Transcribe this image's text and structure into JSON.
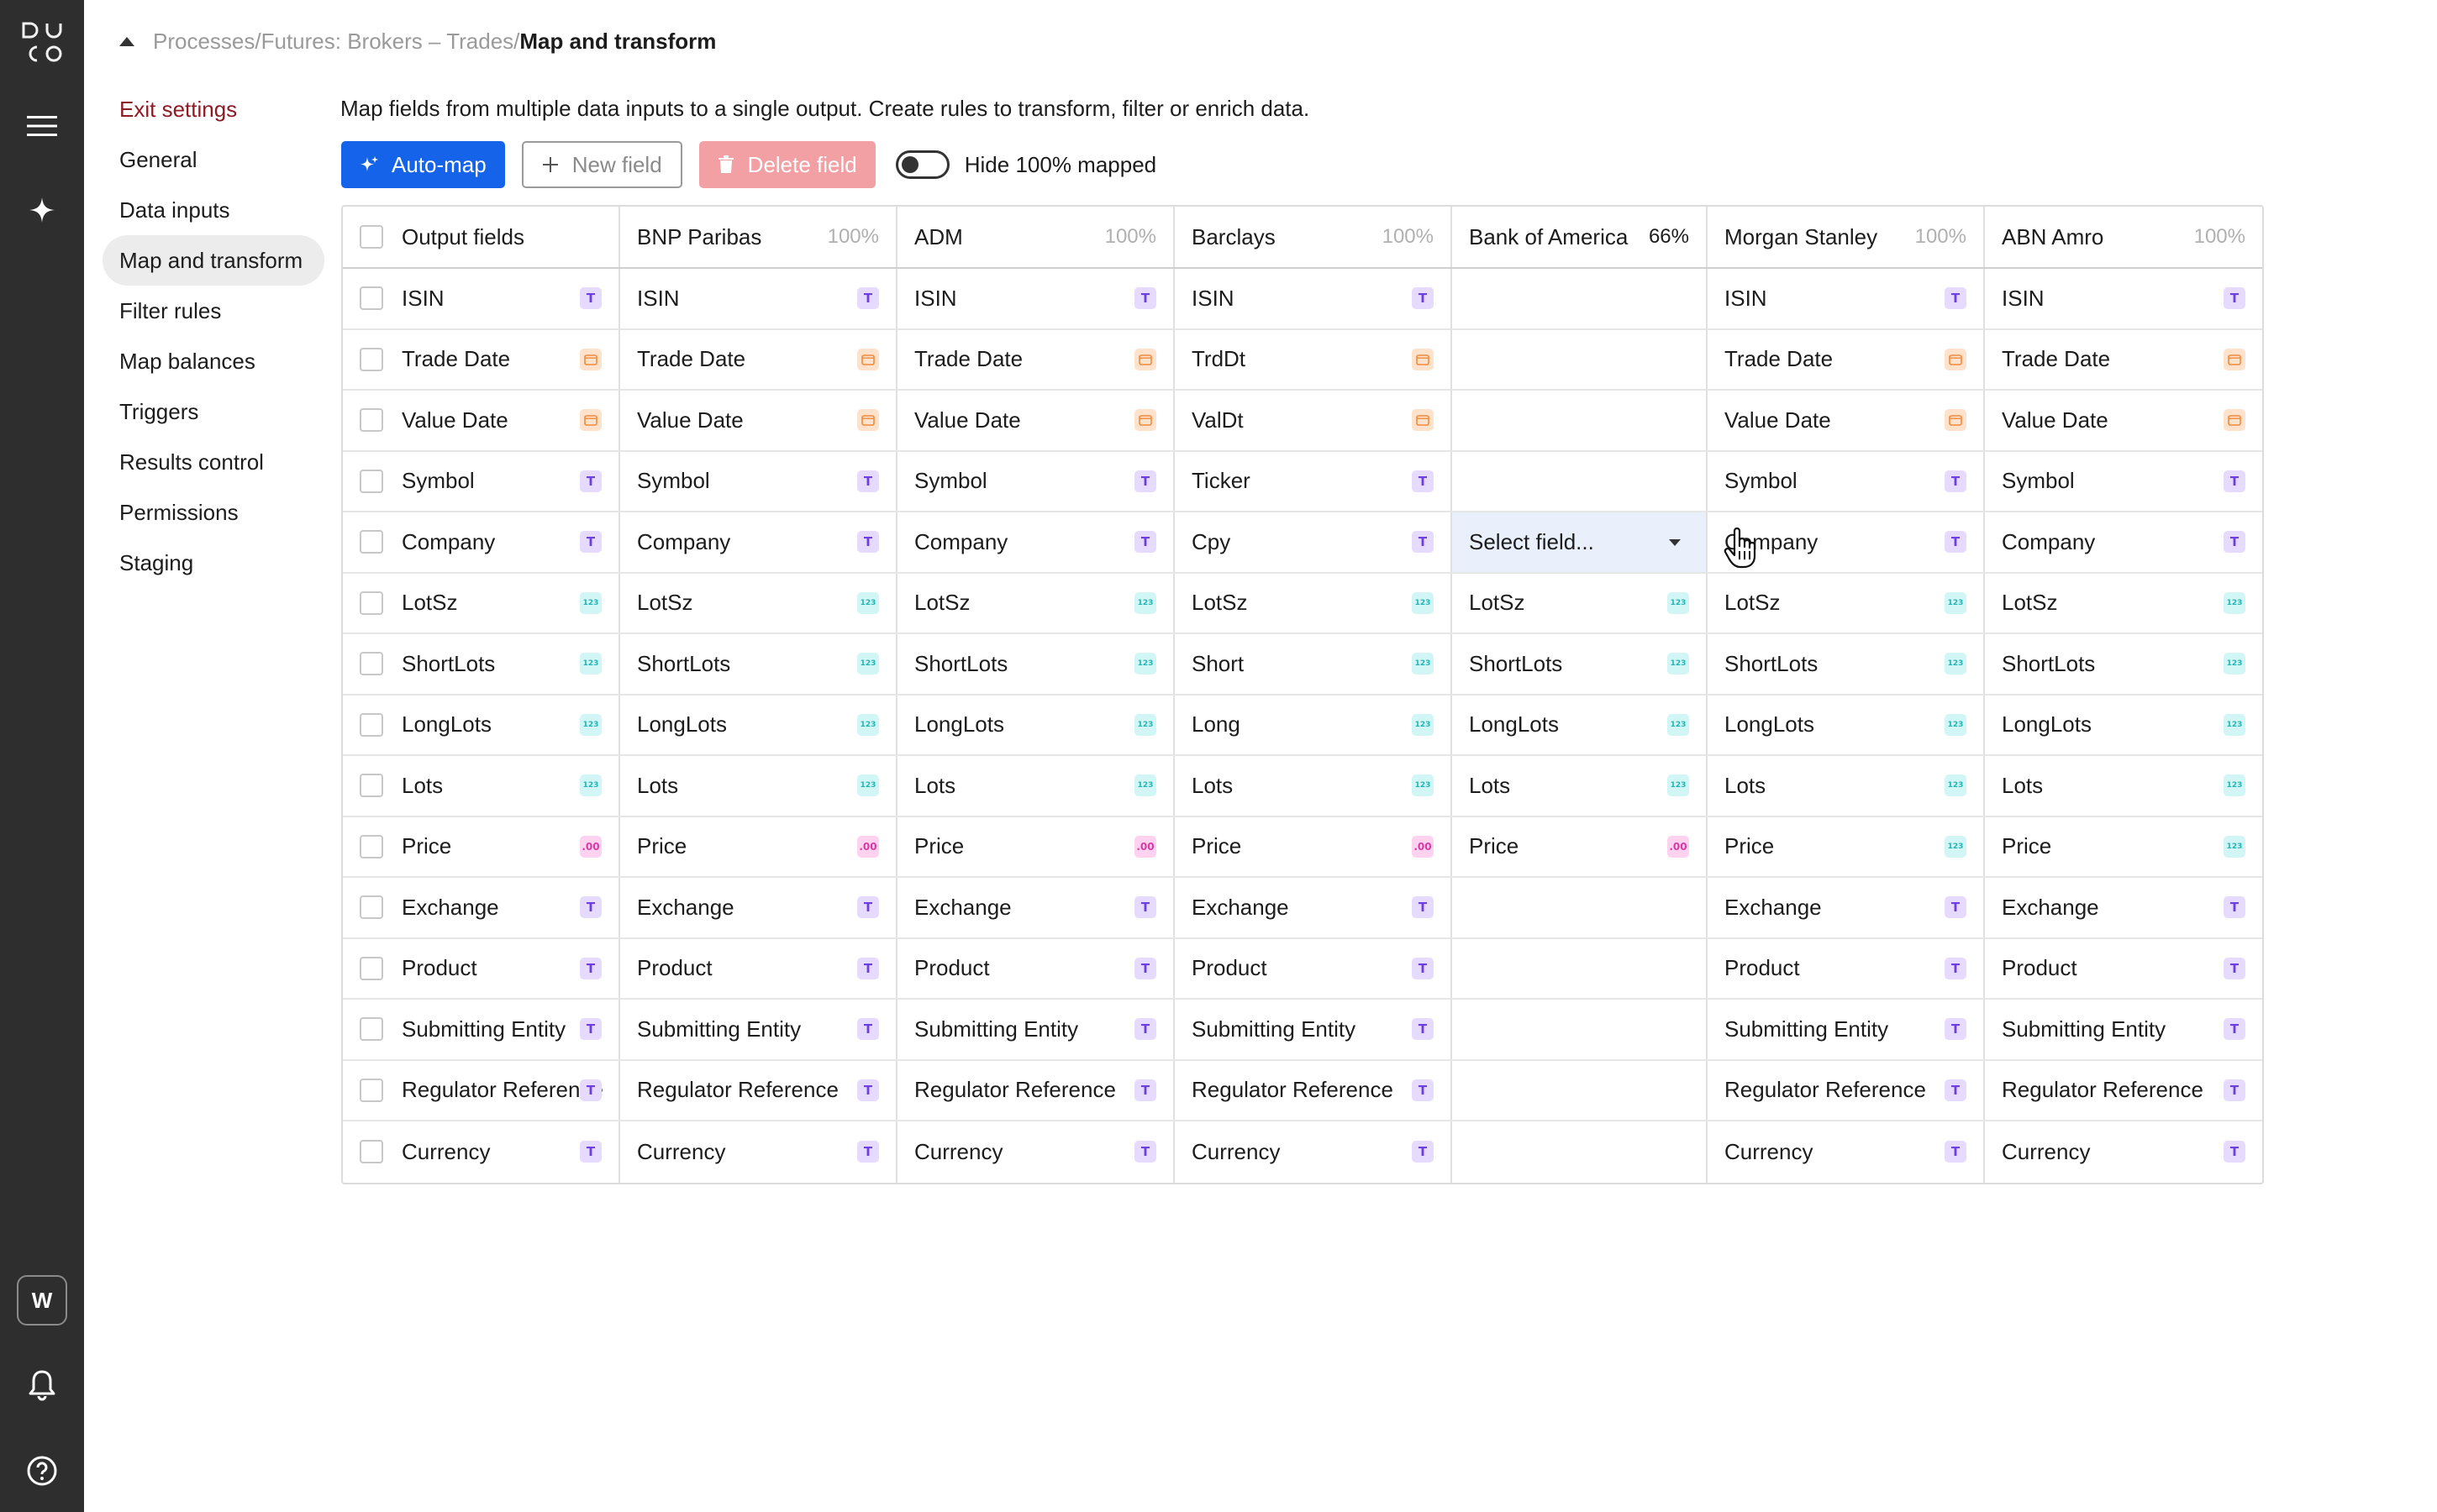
{
  "app": {
    "logo_letters": "DUCO",
    "workspace_initial": "W"
  },
  "breadcrumb": {
    "path": "Processes/Futures: Brokers – Trades/",
    "current": "Map and transform"
  },
  "settings_nav": [
    {
      "label": "Exit settings"
    },
    {
      "label": "General"
    },
    {
      "label": "Data inputs"
    },
    {
      "label": "Map and transform"
    },
    {
      "label": "Filter rules"
    },
    {
      "label": "Map balances"
    },
    {
      "label": "Triggers"
    },
    {
      "label": "Results control"
    },
    {
      "label": "Permissions"
    },
    {
      "label": "Staging"
    }
  ],
  "description": "Map fields from multiple data inputs to a single output. Create rules to transform, filter or enrich data.",
  "toolbar": {
    "automap_label": "Auto-map",
    "newfield_label": "New field",
    "delete_label": "Delete field",
    "hide_label": "Hide 100% mapped",
    "hide_toggle_on": false
  },
  "badge_types": {
    "T": "T",
    "date": "▭",
    "num": "123",
    "dec": ".00"
  },
  "colors": {
    "rail": "#2e2e2e",
    "primary": "#1463e8",
    "exit": "#8b1c24",
    "danger_disabled": "#f2a0a4",
    "selected_cell": "#e9f0fc"
  },
  "table": {
    "output_header": "Output fields",
    "sources": [
      {
        "name": "BNP Paribas",
        "pct": "100%"
      },
      {
        "name": "ADM",
        "pct": "100%"
      },
      {
        "name": "Barclays",
        "pct": "100%"
      },
      {
        "name": "Bank of America",
        "pct": "66%"
      },
      {
        "name": "Morgan Stanley",
        "pct": "100%"
      },
      {
        "name": "ABN Amro",
        "pct": "100%"
      }
    ],
    "dropdown_placeholder": "Select field...",
    "rows": [
      {
        "output": "ISIN",
        "type": "T",
        "cells": [
          [
            "ISIN",
            "T"
          ],
          [
            "ISIN",
            "T"
          ],
          [
            "ISIN",
            "T"
          ],
          [
            "",
            ""
          ],
          [
            "ISIN",
            "T"
          ],
          [
            "ISIN",
            "T"
          ]
        ]
      },
      {
        "output": "Trade Date",
        "type": "date",
        "cells": [
          [
            "Trade Date",
            "date"
          ],
          [
            "Trade Date",
            "date"
          ],
          [
            "TrdDt",
            "date"
          ],
          [
            "",
            ""
          ],
          [
            "Trade Date",
            "date"
          ],
          [
            "Trade Date",
            "date"
          ]
        ]
      },
      {
        "output": "Value Date",
        "type": "date",
        "cells": [
          [
            "Value Date",
            "date"
          ],
          [
            "Value Date",
            "date"
          ],
          [
            "ValDt",
            "date"
          ],
          [
            "",
            ""
          ],
          [
            "Value Date",
            "date"
          ],
          [
            "Value Date",
            "date"
          ]
        ]
      },
      {
        "output": "Symbol",
        "type": "T",
        "cells": [
          [
            "Symbol",
            "T"
          ],
          [
            "Symbol",
            "T"
          ],
          [
            "Ticker",
            "T"
          ],
          [
            "",
            ""
          ],
          [
            "Symbol",
            "T"
          ],
          [
            "Symbol",
            "T"
          ]
        ]
      },
      {
        "output": "Company",
        "type": "T",
        "cells": [
          [
            "Company",
            "T"
          ],
          [
            "Company",
            "T"
          ],
          [
            "Cpy",
            "T"
          ],
          [
            "SELECT",
            ""
          ],
          [
            "Company",
            "T"
          ],
          [
            "Company",
            "T"
          ]
        ]
      },
      {
        "output": "LotSz",
        "type": "num",
        "cells": [
          [
            "LotSz",
            "num"
          ],
          [
            "LotSz",
            "num"
          ],
          [
            "LotSz",
            "num"
          ],
          [
            "LotSz",
            "num"
          ],
          [
            "LotSz",
            "num"
          ],
          [
            "LotSz",
            "num"
          ]
        ]
      },
      {
        "output": "ShortLots",
        "type": "num",
        "cells": [
          [
            "ShortLots",
            "num"
          ],
          [
            "ShortLots",
            "num"
          ],
          [
            "Short",
            "num"
          ],
          [
            "ShortLots",
            "num"
          ],
          [
            "ShortLots",
            "num"
          ],
          [
            "ShortLots",
            "num"
          ]
        ]
      },
      {
        "output": "LongLots",
        "type": "num",
        "cells": [
          [
            "LongLots",
            "num"
          ],
          [
            "LongLots",
            "num"
          ],
          [
            "Long",
            "num"
          ],
          [
            "LongLots",
            "num"
          ],
          [
            "LongLots",
            "num"
          ],
          [
            "LongLots",
            "num"
          ]
        ]
      },
      {
        "output": "Lots",
        "type": "num",
        "cells": [
          [
            "Lots",
            "num"
          ],
          [
            "Lots",
            "num"
          ],
          [
            "Lots",
            "num"
          ],
          [
            "Lots",
            "num"
          ],
          [
            "Lots",
            "num"
          ],
          [
            "Lots",
            "num"
          ]
        ]
      },
      {
        "output": "Price",
        "type": "dec",
        "cells": [
          [
            "Price",
            "dec"
          ],
          [
            "Price",
            "dec"
          ],
          [
            "Price",
            "dec"
          ],
          [
            "Price",
            "dec"
          ],
          [
            "Price",
            "num"
          ],
          [
            "Price",
            "num"
          ]
        ]
      },
      {
        "output": "Exchange",
        "type": "T",
        "cells": [
          [
            "Exchange",
            "T"
          ],
          [
            "Exchange",
            "T"
          ],
          [
            "Exchange",
            "T"
          ],
          [
            "",
            ""
          ],
          [
            "Exchange",
            "T"
          ],
          [
            "Exchange",
            "T"
          ]
        ]
      },
      {
        "output": "Product",
        "type": "T",
        "cells": [
          [
            "Product",
            "T"
          ],
          [
            "Product",
            "T"
          ],
          [
            "Product",
            "T"
          ],
          [
            "",
            ""
          ],
          [
            "Product",
            "T"
          ],
          [
            "Product",
            "T"
          ]
        ]
      },
      {
        "output": "Submitting Entity",
        "type": "T",
        "cells": [
          [
            "Submitting Entity",
            "T"
          ],
          [
            "Submitting Entity",
            "T"
          ],
          [
            "Submitting Entity",
            "T"
          ],
          [
            "",
            ""
          ],
          [
            "Submitting Entity",
            "T"
          ],
          [
            "Submitting Entity",
            "T"
          ]
        ]
      },
      {
        "output": "Regulator Reference",
        "type": "T",
        "cells": [
          [
            "Regulator Reference",
            "T"
          ],
          [
            "Regulator Reference",
            "T"
          ],
          [
            "Regulator Reference",
            "T"
          ],
          [
            "",
            ""
          ],
          [
            "Regulator Reference",
            "T"
          ],
          [
            "Regulator Reference",
            "T"
          ]
        ]
      },
      {
        "output": "Currency",
        "type": "T",
        "cells": [
          [
            "Currency",
            "T"
          ],
          [
            "Currency",
            "T"
          ],
          [
            "Currency",
            "T"
          ],
          [
            "",
            ""
          ],
          [
            "Currency",
            "T"
          ],
          [
            "Currency",
            "T"
          ]
        ]
      }
    ]
  }
}
